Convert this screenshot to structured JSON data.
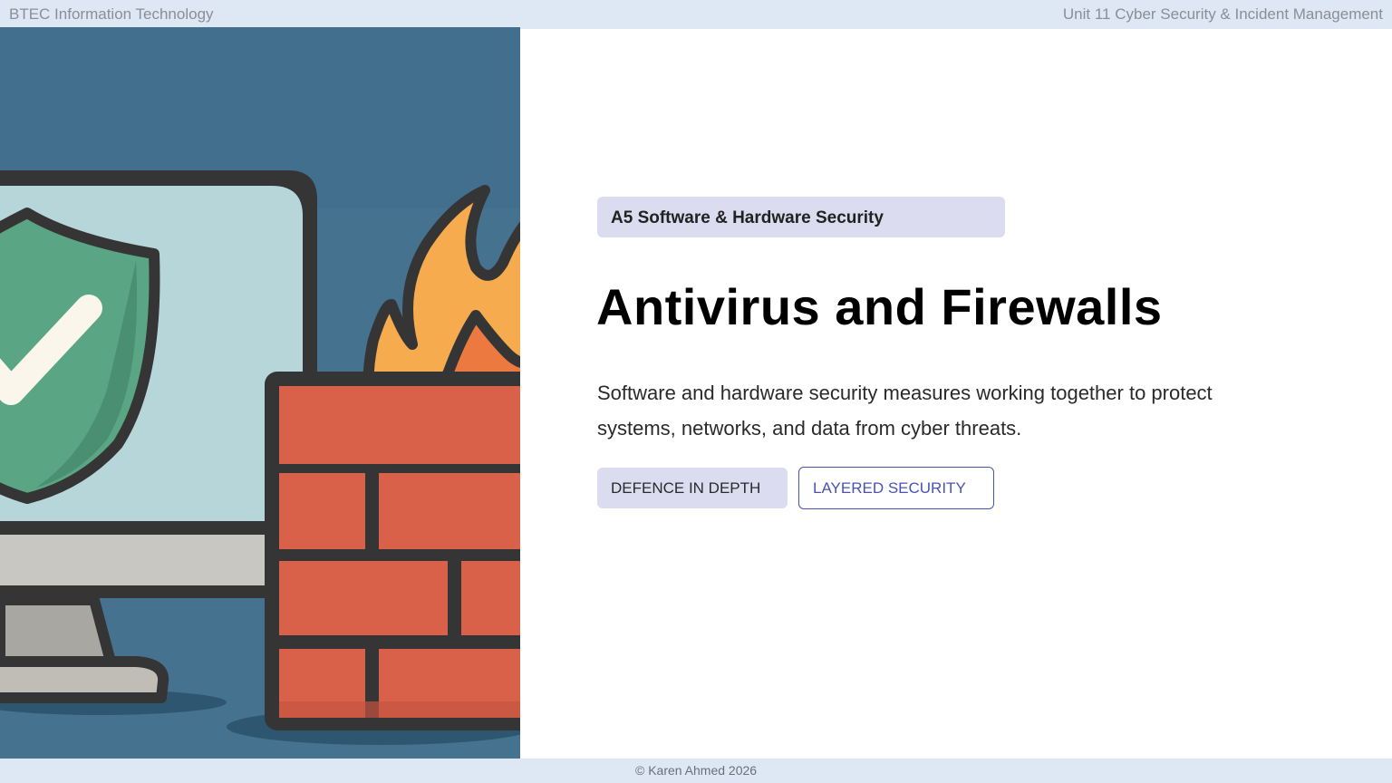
{
  "header": {
    "left_text": "BTEC Information Technology",
    "right_text": "Unit 11 Cyber Security & Incident Management"
  },
  "slide": {
    "section_tag": "A5 Software & Hardware Security",
    "title": "Antivirus and Firewalls",
    "description": "Software and hardware security measures working together to protect systems, networks, and data from cyber threats.",
    "tags": [
      "DEFENCE IN DEPTH",
      "LAYERED SECURITY"
    ]
  },
  "illustration": {
    "icons": [
      "monitor-icon",
      "shield-check-icon",
      "brick-wall-icon",
      "flame-icon"
    ],
    "colors": {
      "background": "#44728f",
      "shield": "#5aa583",
      "bricks": "#d9614a",
      "flame_outer": "#f5ab4e",
      "flame_inner": "#ec7a40"
    }
  },
  "footer": {
    "copyright": "© Karen Ahmed 2026"
  }
}
